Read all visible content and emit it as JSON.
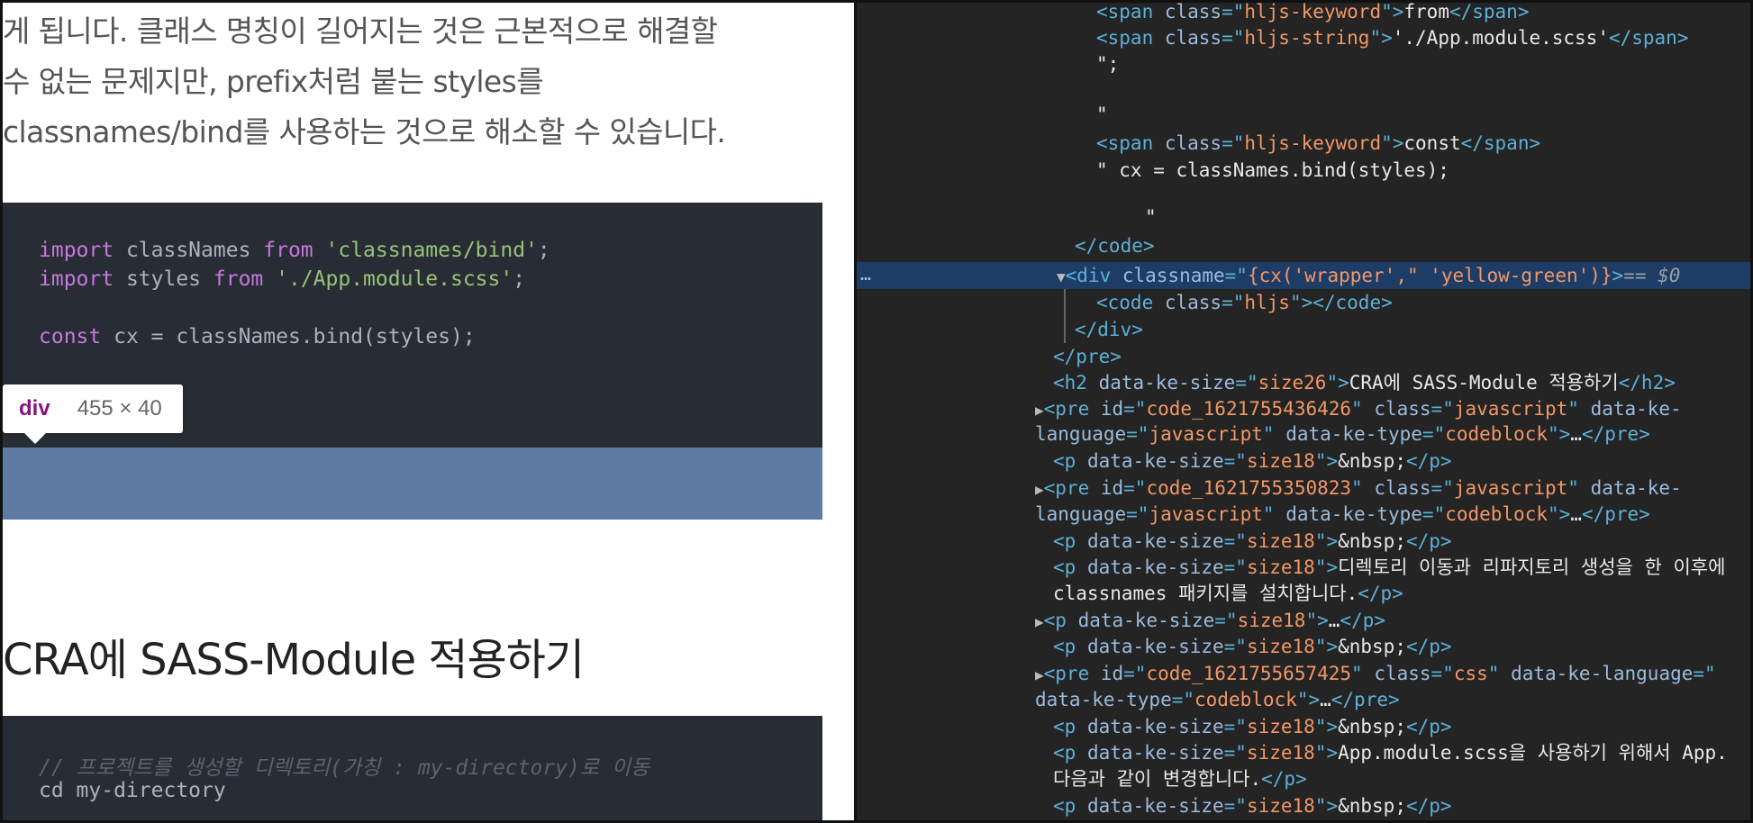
{
  "article": {
    "paragraph": [
      "게 됩니다. 클래스 명칭이 길어지는 것은 근본적으로 해결할",
      "수 없는 문제지만, prefix처럼 붙는 styles를",
      "classnames/bind를 사용하는 것으로 해소할 수 있습니다."
    ],
    "code1": {
      "line1": {
        "kw1": "import",
        "id": " classNames ",
        "kw2": "from",
        "sp": " ",
        "str": "'classnames/bind'",
        "end": ";"
      },
      "line2": {
        "kw1": "import",
        "id": " styles ",
        "kw2": "from",
        "sp": " ",
        "str": "'./App.module.scss'",
        "end": ";"
      },
      "line3": {
        "kw": "const",
        "rest": " cx = classNames.bind(styles);"
      }
    },
    "tooltip": {
      "tag": "div",
      "size": "455 × 40"
    },
    "heading": "CRA에 SASS-Module 적용하기",
    "code2": {
      "comment": "// 프로젝트를 생성할 디렉토리(가칭 : my-directory)로 이동",
      "command": "cd my-directory"
    }
  },
  "devtools": {
    "dots": "…",
    "eq_marker": "== $0",
    "lines": {
      "l1": {
        "a": "<span ",
        "b": "class",
        "c": "=\"",
        "d": "hljs-keyword",
        "e": "\">",
        "f": "from",
        "g": "</span>"
      },
      "l2": {
        "a": "<span ",
        "b": "class",
        "c": "=\"",
        "d": "hljs-string",
        "e": "\">",
        "f": "'./App.module.scss'",
        "g": "</span>"
      },
      "l3": "\";",
      "l4": "\"",
      "l5": {
        "a": "<span ",
        "b": "class",
        "c": "=\"",
        "d": "hljs-keyword",
        "e": "\">",
        "f": "const",
        "g": "</span>"
      },
      "l6": "\" cx = classNames.bind(styles);",
      "l7": "\"",
      "l8": "</code>",
      "l9": {
        "a": "<div ",
        "b": "classname",
        "c": "=\"",
        "d": "{cx('wrapper',\" 'yellow-green')}",
        "e": ">"
      },
      "l10": {
        "a": "<code ",
        "b": "class",
        "c": "=\"",
        "d": "hljs",
        "e": "\"></code>"
      },
      "l11": "</div>",
      "l12": "</pre>",
      "l13": {
        "a": "<h2 ",
        "b": "data-ke-size",
        "c": "=\"",
        "d": "size26",
        "e": "\">",
        "f": "CRA에 SASS-Module 적용하기",
        "g": "</h2>"
      },
      "l14": {
        "a": "<pre ",
        "b": "id",
        "c": "=\"",
        "d": "code_1621755436426",
        "e": "\" ",
        "f": "class",
        "g": "=\"",
        "h": "javascript",
        "i": "\" ",
        "j": "data-ke-"
      },
      "l15": {
        "a": "language",
        "b": "=\"",
        "c": "javascript",
        "d": "\" ",
        "e": "data-ke-type",
        "f": "=\"",
        "g": "codeblock",
        "h": "\">",
        "i": "…",
        "j": "</pre>"
      },
      "l16": {
        "a": "<p ",
        "b": "data-ke-size",
        "c": "=\"",
        "d": "size18",
        "e": "\">",
        "f": "&nbsp;",
        "g": "</p>"
      },
      "l17": {
        "a": "<pre ",
        "b": "id",
        "c": "=\"",
        "d": "code_1621755350823",
        "e": "\" ",
        "f": "class",
        "g": "=\"",
        "h": "javascript",
        "i": "\" ",
        "j": "data-ke-"
      },
      "l18": {
        "a": "language",
        "b": "=\"",
        "c": "javascript",
        "d": "\" ",
        "e": "data-ke-type",
        "f": "=\"",
        "g": "codeblock",
        "h": "\">",
        "i": "…",
        "j": "</pre>"
      },
      "l19": {
        "a": "<p ",
        "b": "data-ke-size",
        "c": "=\"",
        "d": "size18",
        "e": "\">",
        "f": "&nbsp;",
        "g": "</p>"
      },
      "l20": {
        "a": "<p ",
        "b": "data-ke-size",
        "c": "=\"",
        "d": "size18",
        "e": "\">",
        "f": "디렉토리 이동과 리파지토리 생성을 한 이후에"
      },
      "l21": {
        "a": "classnames 패키지를 설치합니다.",
        "b": "</p>"
      },
      "l22": {
        "a": "<p ",
        "b": "data-ke-size",
        "c": "=\"",
        "d": "size18",
        "e": "\">",
        "f": "…",
        "g": "</p>"
      },
      "l23": {
        "a": "<p ",
        "b": "data-ke-size",
        "c": "=\"",
        "d": "size18",
        "e": "\">",
        "f": "&nbsp;",
        "g": "</p>"
      },
      "l24": {
        "a": "<pre ",
        "b": "id",
        "c": "=\"",
        "d": "code_1621755657425",
        "e": "\" ",
        "f": "class",
        "g": "=\"",
        "h": "css",
        "i": "\" ",
        "j": "data-ke-language",
        "k": "=\""
      },
      "l25": {
        "a": "data-ke-type",
        "b": "=\"",
        "c": "codeblock",
        "d": "\">",
        "e": "…",
        "f": "</pre>"
      },
      "l26": {
        "a": "<p ",
        "b": "data-ke-size",
        "c": "=\"",
        "d": "size18",
        "e": "\">",
        "f": "&nbsp;",
        "g": "</p>"
      },
      "l27": {
        "a": "<p ",
        "b": "data-ke-size",
        "c": "=\"",
        "d": "size18",
        "e": "\">",
        "f": "App.module.scss을 사용하기 위해서 App."
      },
      "l28": {
        "a": "다음과 같이 변경합니다.",
        "b": "</p>"
      },
      "l29": {
        "a": "<p ",
        "b": "data-ke-size",
        "c": "=\"",
        "d": "size18",
        "e": "\">",
        "f": "&nbsp;",
        "g": "</p>"
      }
    }
  }
}
